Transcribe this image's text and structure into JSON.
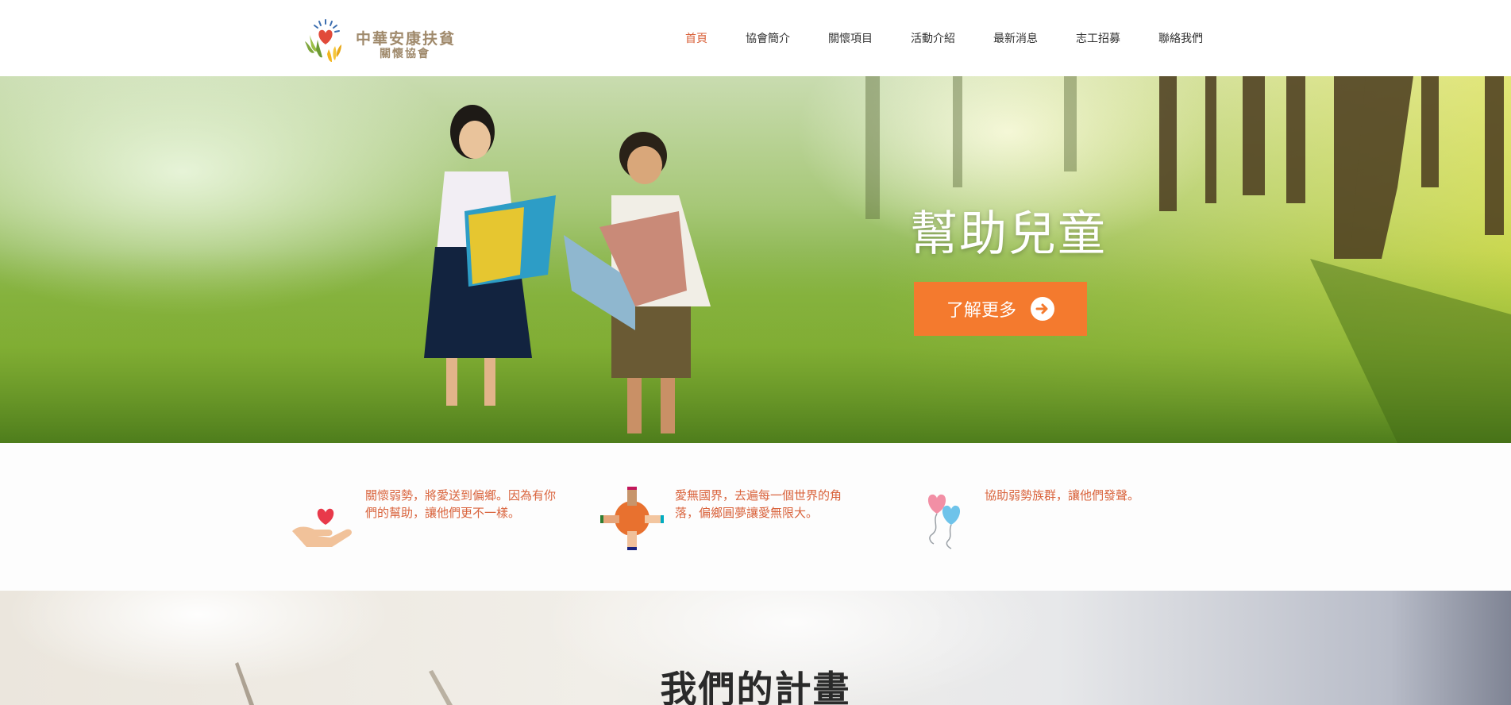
{
  "logo": {
    "line1": "中華安康扶貧",
    "line2": "關懷協會",
    "icon": "hands-heart-logo-icon"
  },
  "nav": {
    "items": [
      {
        "label": "首頁",
        "active": true
      },
      {
        "label": "協會簡介",
        "active": false
      },
      {
        "label": "關懷項目",
        "active": false
      },
      {
        "label": "活動介紹",
        "active": false
      },
      {
        "label": "最新消息",
        "active": false
      },
      {
        "label": "志工招募",
        "active": false
      },
      {
        "label": "聯絡我們",
        "active": false
      }
    ]
  },
  "hero": {
    "title": "幫助兒童",
    "button_label": "了解更多",
    "button_icon": "arrow-right-circle-icon"
  },
  "features": [
    {
      "icon": "heart-in-hand-icon",
      "text": "關懷弱勢，將愛送到偏鄉。因為有你們的幫助，讓他們更不一樣。"
    },
    {
      "icon": "joined-hands-icon",
      "text": "愛無國界，去遍每一個世界的角落，偏鄉圓夢讓愛無限大。"
    },
    {
      "icon": "heart-balloons-icon",
      "text": "協助弱勢族群，讓他們發聲。"
    }
  ],
  "projects": {
    "title": "我們的計畫"
  },
  "colors": {
    "accent": "#d9633c",
    "button": "#f47a2e",
    "logo_text": "#a08a6c"
  }
}
